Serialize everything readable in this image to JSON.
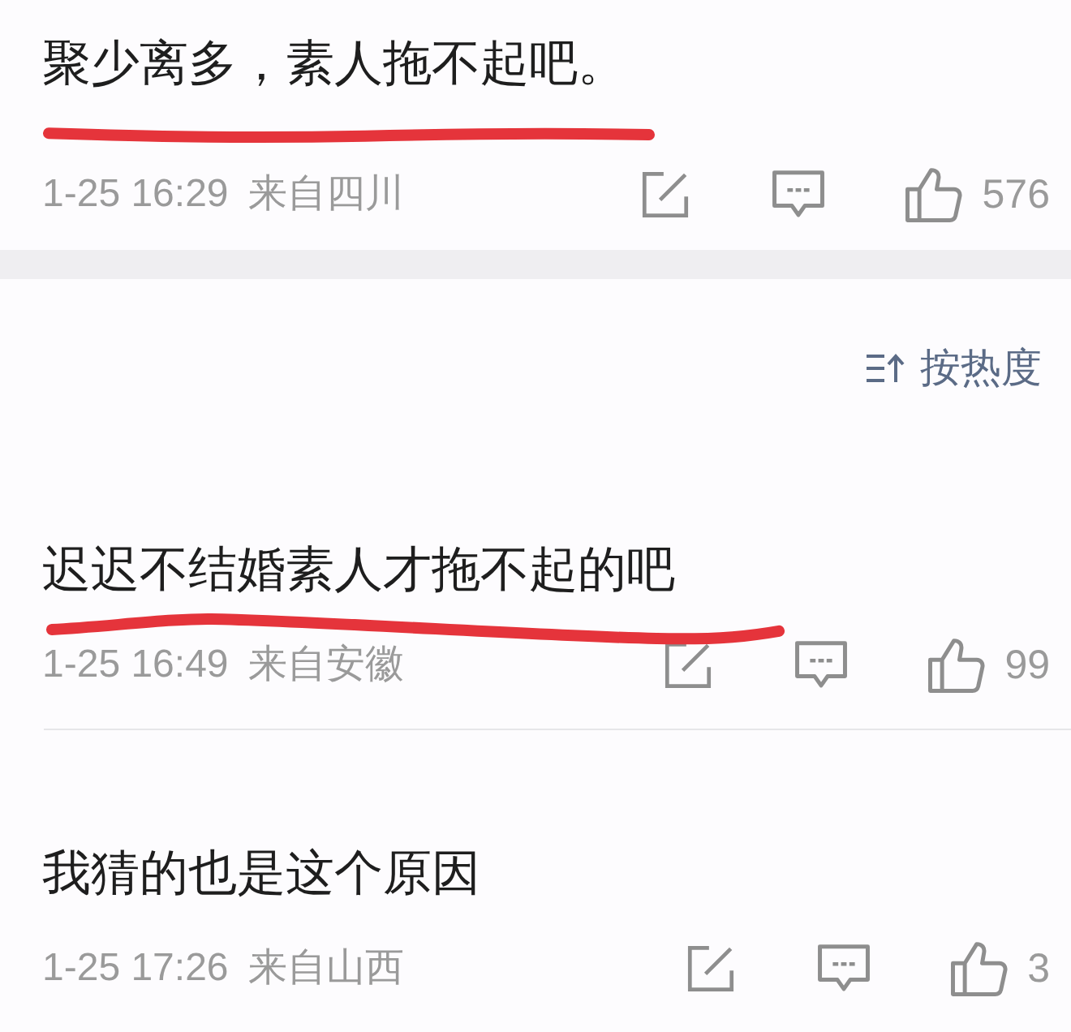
{
  "previous_comment": {
    "text": "聚少离多，素人拖不起吧。",
    "time": "1-25 16:29",
    "location": "来自四川",
    "likes": "576",
    "underlined": true
  },
  "sort_button": {
    "label": "按热度"
  },
  "comments": [
    {
      "text": "迟迟不结婚素人才拖不起的吧",
      "time": "1-25 16:49",
      "location": "来自安徽",
      "likes": "99",
      "underlined": true
    },
    {
      "text": "我猜的也是这个原因",
      "time": "1-25 17:26",
      "location": "来自山西",
      "likes": "3",
      "underlined": false
    }
  ]
}
